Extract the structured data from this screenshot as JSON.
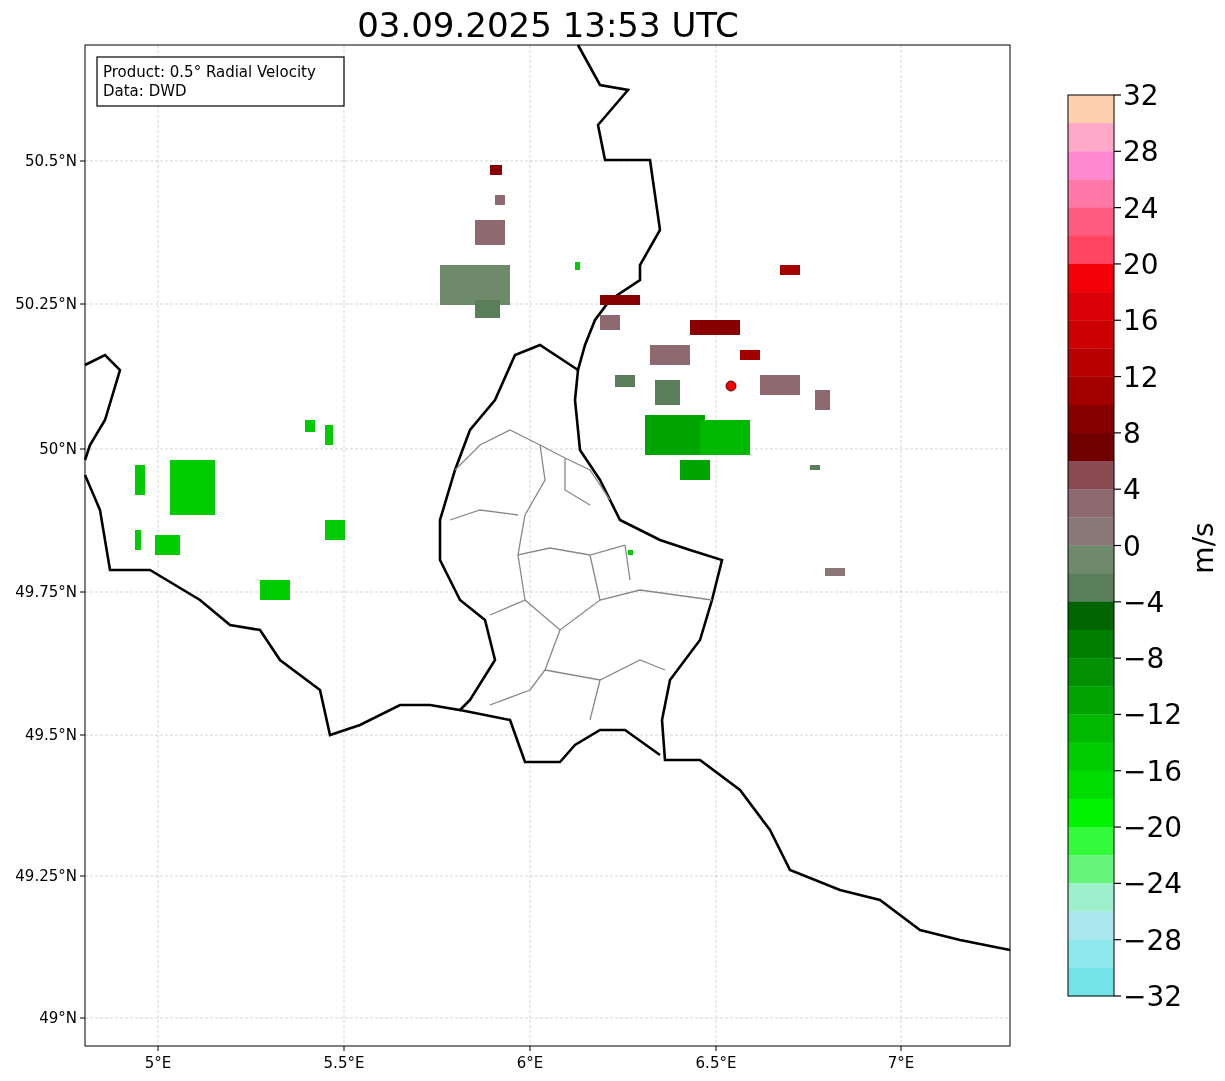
{
  "title": "03.09.2025 13:53 UTC",
  "info_box": {
    "lines": [
      "Product: 0.5° Radial Velocity",
      "Data: DWD"
    ]
  },
  "map": {
    "x_ticks": [
      "5°E",
      "5.5°E",
      "6°E",
      "6.5°E",
      "7°E"
    ],
    "y_ticks": [
      "50.5°N",
      "50.25°N",
      "50°N",
      "49.75°N",
      "49.5°N",
      "49.25°N",
      "49°N"
    ]
  },
  "colorbar": {
    "label": "m/s",
    "bins": [
      {
        "color": "#ffd0b0"
      },
      {
        "color": "#ffa8c8"
      },
      {
        "color": "#ff88d0"
      },
      {
        "color": "#ff78a8"
      },
      {
        "color": "#ff5a80"
      },
      {
        "color": "#ff4560"
      },
      {
        "color": "#f40008"
      },
      {
        "color": "#dc0008"
      },
      {
        "color": "#cc0000"
      },
      {
        "color": "#b80000"
      },
      {
        "color": "#a40000"
      },
      {
        "color": "#880000"
      },
      {
        "color": "#700000"
      },
      {
        "color": "#8a4a52"
      },
      {
        "color": "#8e6a70"
      },
      {
        "color": "#8a7878"
      },
      {
        "color": "#6e8a6a"
      },
      {
        "color": "#5a7d5a"
      },
      {
        "color": "#006400"
      },
      {
        "color": "#007e00"
      },
      {
        "color": "#009000"
      },
      {
        "color": "#00a400"
      },
      {
        "color": "#00b800"
      },
      {
        "color": "#00cc00"
      },
      {
        "color": "#00dc00"
      },
      {
        "color": "#00f400"
      },
      {
        "color": "#33fa3a"
      },
      {
        "color": "#66f57c"
      },
      {
        "color": "#9ef0cc"
      },
      {
        "color": "#a8e8ee"
      },
      {
        "color": "#8ee8ec"
      },
      {
        "color": "#74e3e8"
      }
    ],
    "ticks": [
      "32",
      "28",
      "24",
      "20",
      "16",
      "12",
      "8",
      "4",
      "0",
      "−4",
      "−8",
      "−12",
      "−16",
      "−20",
      "−24",
      "−28",
      "−32"
    ]
  }
}
